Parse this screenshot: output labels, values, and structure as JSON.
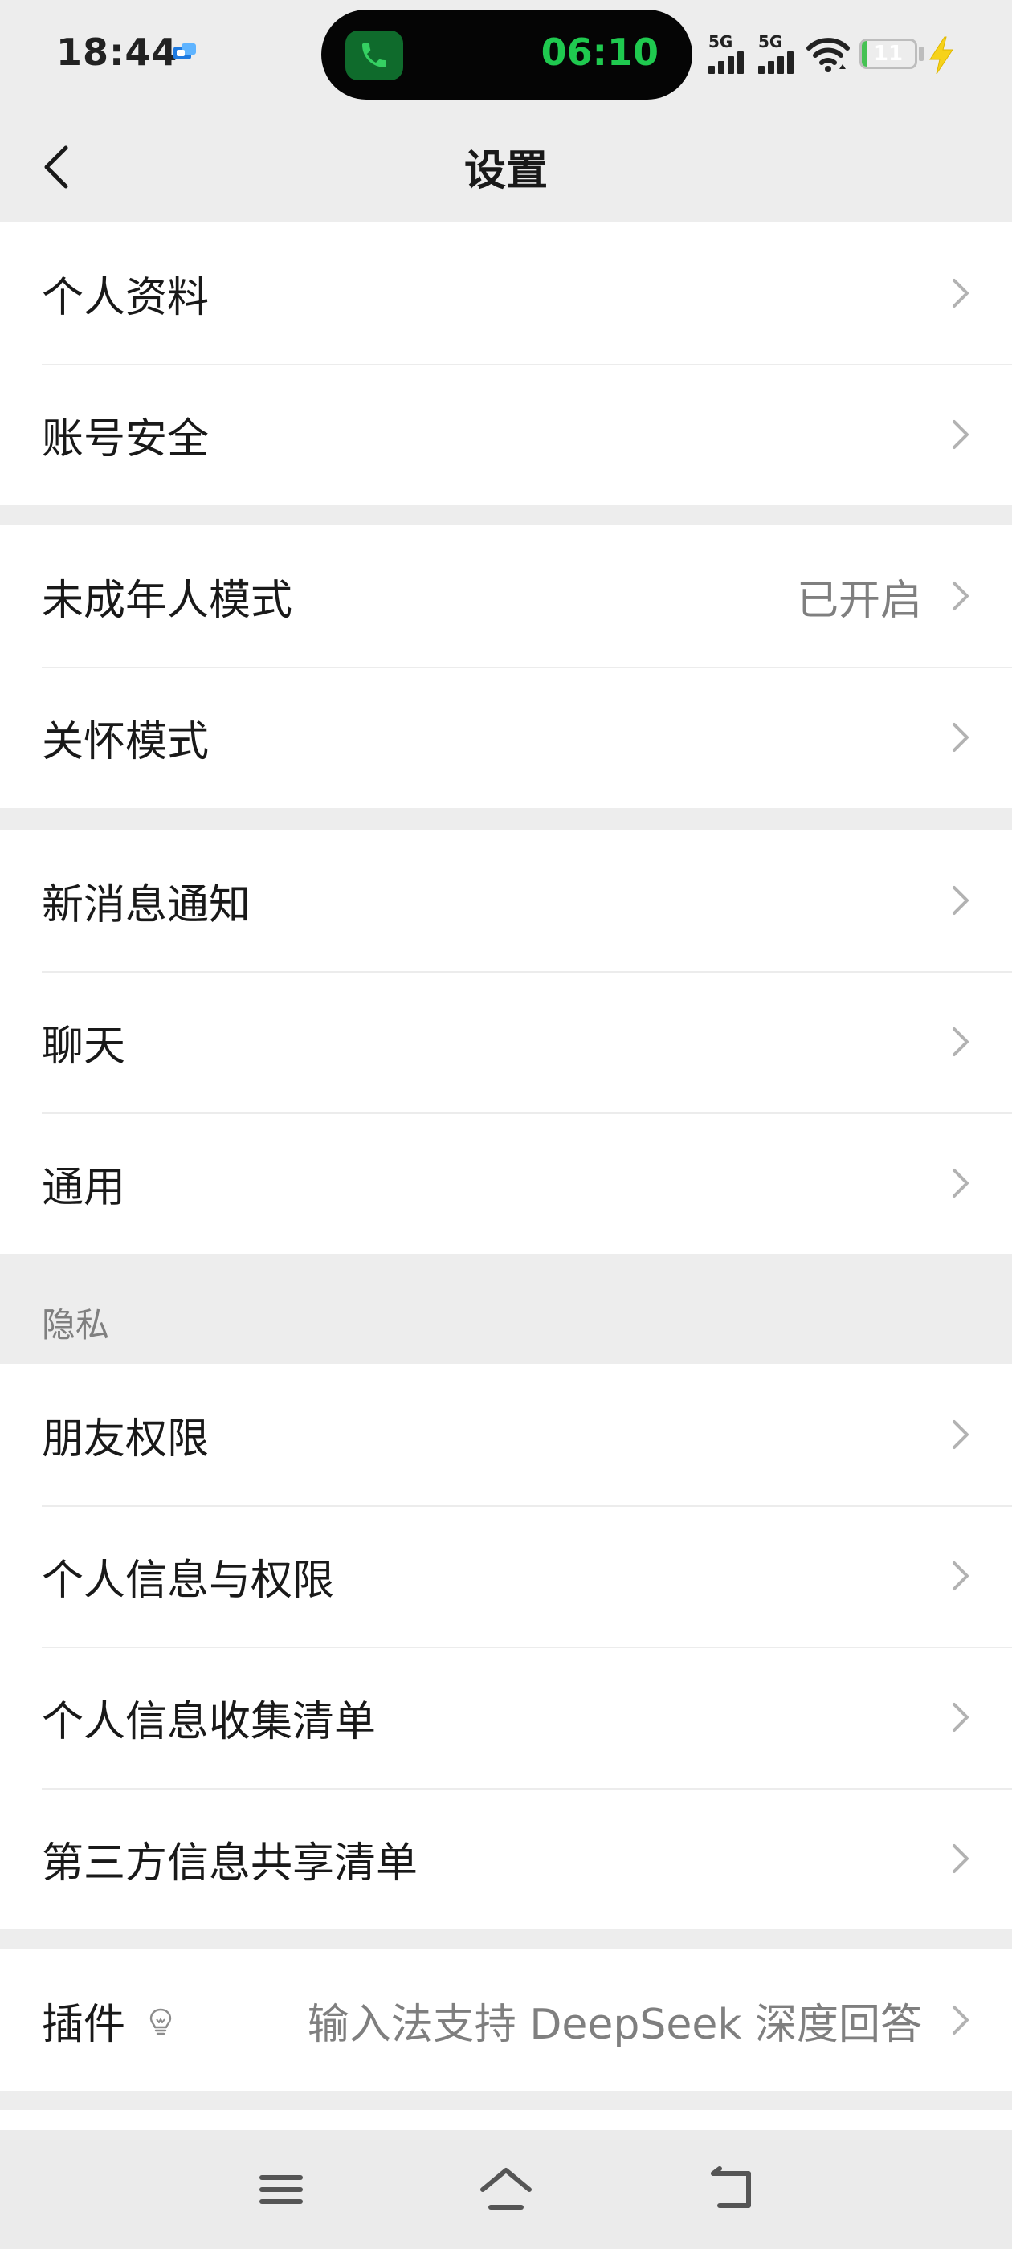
{
  "status_bar": {
    "time": "18:44",
    "call_timer": "06:10",
    "signal1_label": "5G",
    "signal2_label": "5G",
    "battery_level": "11",
    "battery_percent": 11
  },
  "header": {
    "title": "设置"
  },
  "groups": {
    "account": {
      "items": [
        {
          "label": "个人资料"
        },
        {
          "label": "账号安全"
        }
      ]
    },
    "modes": {
      "items": [
        {
          "label": "未成年人模式",
          "value": "已开启"
        },
        {
          "label": "关怀模式"
        }
      ]
    },
    "general": {
      "items": [
        {
          "label": "新消息通知"
        },
        {
          "label": "聊天"
        },
        {
          "label": "通用"
        }
      ]
    },
    "privacy": {
      "section_label": "隐私",
      "items": [
        {
          "label": "朋友权限"
        },
        {
          "label": "个人信息与权限"
        },
        {
          "label": "个人信息收集清单"
        },
        {
          "label": "第三方信息共享清单"
        }
      ]
    },
    "plugins": {
      "items": [
        {
          "label": "插件",
          "value": "输入法支持 DeepSeek 深度回答",
          "icon": "lightbulb-icon"
        }
      ]
    }
  },
  "colors": {
    "background": "#ededed",
    "card": "#ffffff",
    "primary_text": "#191919",
    "secondary_text": "#7f7f7f",
    "call_green": "#1fc94f"
  }
}
